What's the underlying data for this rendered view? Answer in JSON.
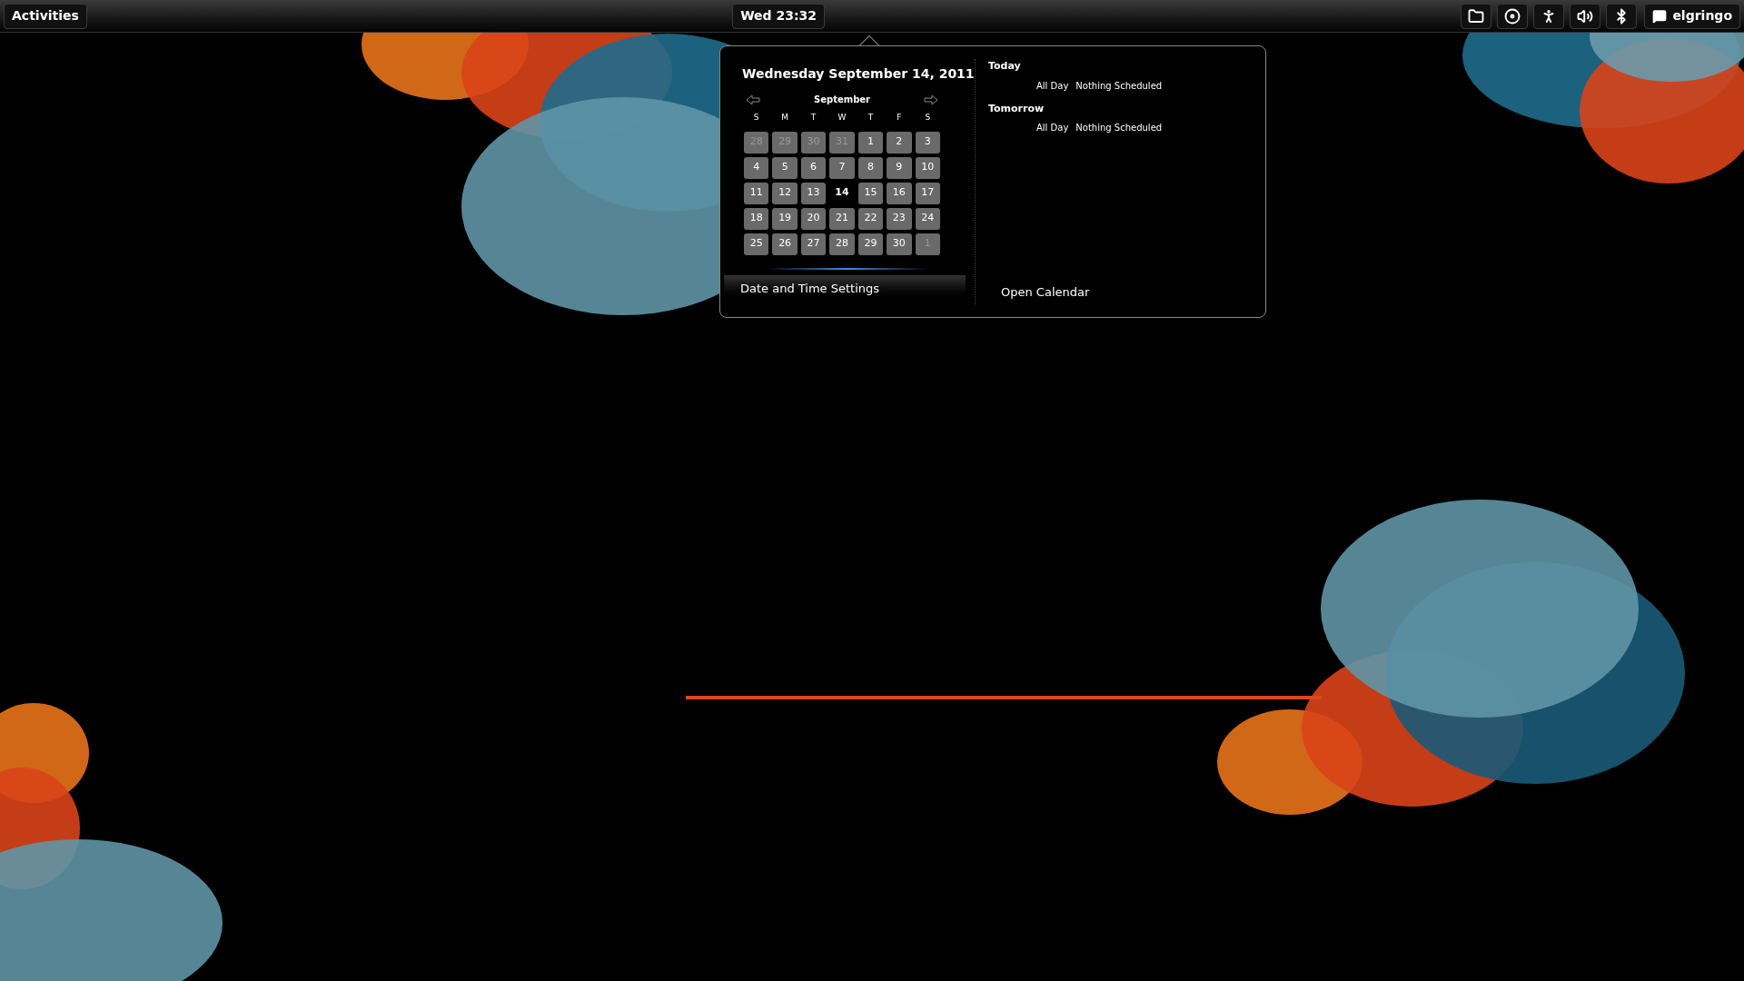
{
  "top_bar": {
    "activities": "Activities",
    "clock": "Wed 23:32",
    "user": "elgringo"
  },
  "calendar_popup": {
    "date_title": "Wednesday September 14, 2011",
    "month": "September",
    "weekdays": [
      "S",
      "M",
      "T",
      "W",
      "T",
      "F",
      "S"
    ],
    "weeks": [
      [
        {
          "label": "28",
          "outside": true,
          "selected": false
        },
        {
          "label": "29",
          "outside": true,
          "selected": false
        },
        {
          "label": "30",
          "outside": true,
          "selected": false
        },
        {
          "label": "31",
          "outside": true,
          "selected": false
        },
        {
          "label": "1",
          "outside": false,
          "selected": false
        },
        {
          "label": "2",
          "outside": false,
          "selected": false
        },
        {
          "label": "3",
          "outside": false,
          "selected": false
        }
      ],
      [
        {
          "label": "4",
          "outside": false,
          "selected": false
        },
        {
          "label": "5",
          "outside": false,
          "selected": false
        },
        {
          "label": "6",
          "outside": false,
          "selected": false
        },
        {
          "label": "7",
          "outside": false,
          "selected": false
        },
        {
          "label": "8",
          "outside": false,
          "selected": false
        },
        {
          "label": "9",
          "outside": false,
          "selected": false
        },
        {
          "label": "10",
          "outside": false,
          "selected": false
        }
      ],
      [
        {
          "label": "11",
          "outside": false,
          "selected": false
        },
        {
          "label": "12",
          "outside": false,
          "selected": false
        },
        {
          "label": "13",
          "outside": false,
          "selected": false
        },
        {
          "label": "14",
          "outside": false,
          "selected": true
        },
        {
          "label": "15",
          "outside": false,
          "selected": false
        },
        {
          "label": "16",
          "outside": false,
          "selected": false
        },
        {
          "label": "17",
          "outside": false,
          "selected": false
        }
      ],
      [
        {
          "label": "18",
          "outside": false,
          "selected": false
        },
        {
          "label": "19",
          "outside": false,
          "selected": false
        },
        {
          "label": "20",
          "outside": false,
          "selected": false
        },
        {
          "label": "21",
          "outside": false,
          "selected": false
        },
        {
          "label": "22",
          "outside": false,
          "selected": false
        },
        {
          "label": "23",
          "outside": false,
          "selected": false
        },
        {
          "label": "24",
          "outside": false,
          "selected": false
        }
      ],
      [
        {
          "label": "25",
          "outside": false,
          "selected": false
        },
        {
          "label": "26",
          "outside": false,
          "selected": false
        },
        {
          "label": "27",
          "outside": false,
          "selected": false
        },
        {
          "label": "28",
          "outside": false,
          "selected": false
        },
        {
          "label": "29",
          "outside": false,
          "selected": false
        },
        {
          "label": "30",
          "outside": false,
          "selected": false
        },
        {
          "label": "1",
          "outside": true,
          "selected": false
        }
      ]
    ],
    "settings_button": "Date and Time Settings",
    "events": [
      {
        "heading": "Today",
        "time": "All Day",
        "text": "Nothing Scheduled"
      },
      {
        "heading": "Tomorrow",
        "time": "All Day",
        "text": "Nothing Scheduled"
      }
    ],
    "open_calendar": "Open Calendar"
  }
}
